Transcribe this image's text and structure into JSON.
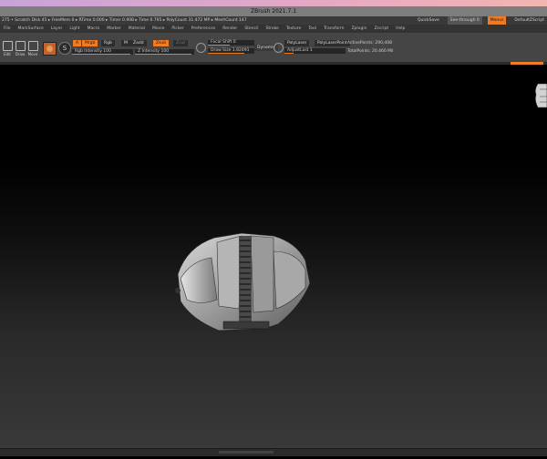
{
  "window": {
    "title": "ZBrush 2021.7.1"
  },
  "status": {
    "left": "275 • Scratch Disk 45 ▸ FreeMem 0 ▸ RTime 0.000 ▸ Timer 0.908 ▸ Time 0.795 ▸ PolyCount 31.472 MP ▸ MeshCount 147",
    "quicksave": "QuickSave",
    "seethrough": "See-through 0",
    "menus": "Menus",
    "defaultscript": "DefaultZScript"
  },
  "menus": [
    "File",
    "MarkSurface",
    "Layer",
    "Light",
    "Macro",
    "Marker",
    "Material",
    "Movie",
    "Picker",
    "Preferences",
    "Render",
    "Stencil",
    "Stroke",
    "Texture",
    "Tool",
    "Transform",
    "Zplugin",
    "Zscript",
    "Help"
  ],
  "toolbar": {
    "edit_label": "Edit",
    "draw_label": "Draw",
    "move_label": "Move",
    "mrgb": "Mrgb",
    "rgb": "Rgb",
    "m": "M",
    "zadd": "Zadd",
    "zsub": "Zsub",
    "zcut": "Zcut",
    "rgb_intensity": "Rgb Intensity 100",
    "z_intensity": "Z Intensity 100",
    "focal_shift": "Focal Shift 0",
    "draw_size": "Draw Size 1.82491",
    "dynamic": "Dynamic",
    "active_points": "ActivePoints: 290,408",
    "total_points": "TotalPoints: 20.460 Mil",
    "polypaint_label": "PolyLaser",
    "polypaint_on": "PolyLaserPoint",
    "adjust_last": "AdjustLast 1"
  },
  "colors": {
    "accent": "#f07b25",
    "toolbar_bg": "#454545",
    "canvas_top": "#000000",
    "canvas_bottom": "#3a3a3a"
  },
  "icons": [
    "edit-icon",
    "draw-icon",
    "move-icon",
    "brush-icon",
    "stroke-icon",
    "material-icon",
    "gizmo-icon"
  ]
}
